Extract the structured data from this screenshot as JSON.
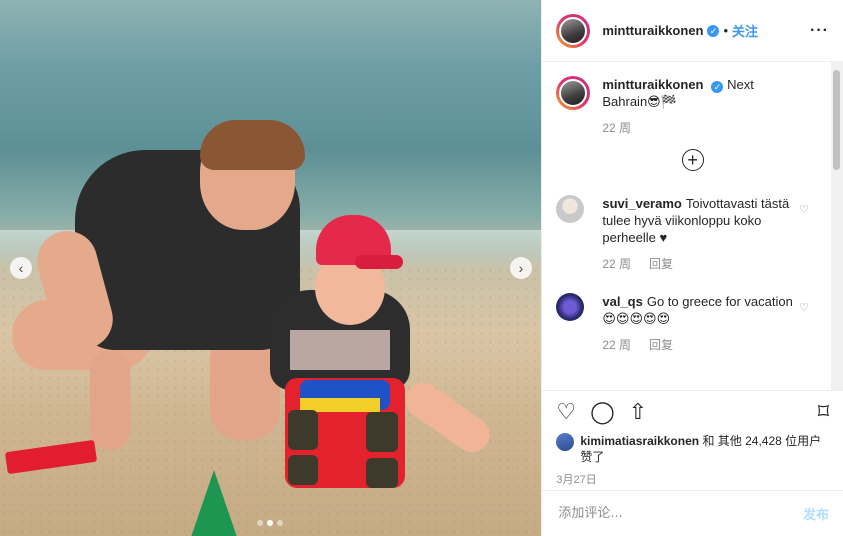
{
  "post": {
    "username": "mintturaikkonen",
    "verified_mark": "✓",
    "dot": "•",
    "follow_label": "关注",
    "more_label": "···"
  },
  "media": {
    "nav_left": "‹",
    "nav_right": "›",
    "slide_count": 3,
    "active_slide": 1
  },
  "caption": {
    "username": "mintturaikkonen",
    "text": "Next Bahrain😎🏁",
    "time": "22 周"
  },
  "load_more_label": "+",
  "comments": [
    {
      "username": "suvi_veramo",
      "text": "Toivottavasti tästä tulee hyvä viikonloppu koko perheelle ♥",
      "time": "22 周",
      "reply_label": "回复"
    },
    {
      "username": "val_qs",
      "text": "Go to greece for vacation 😍😍😍😍😍",
      "time": "22 周",
      "reply_label": "回复"
    }
  ],
  "actions": {
    "like_icon": "♡",
    "comment_icon": "◯",
    "share_icon": "⇧",
    "save_icon": "⌑"
  },
  "likes": {
    "liker": "kimimatiasraikkonen",
    "text": "和 其他 24,428 位用户 赞了"
  },
  "date": "3月27日",
  "comment_box": {
    "placeholder": "添加评论...",
    "post_label": "发布"
  },
  "colors": {
    "accent": "#3897f0",
    "post_disabled": "#b2dffc",
    "muted": "#8e8e8e"
  }
}
